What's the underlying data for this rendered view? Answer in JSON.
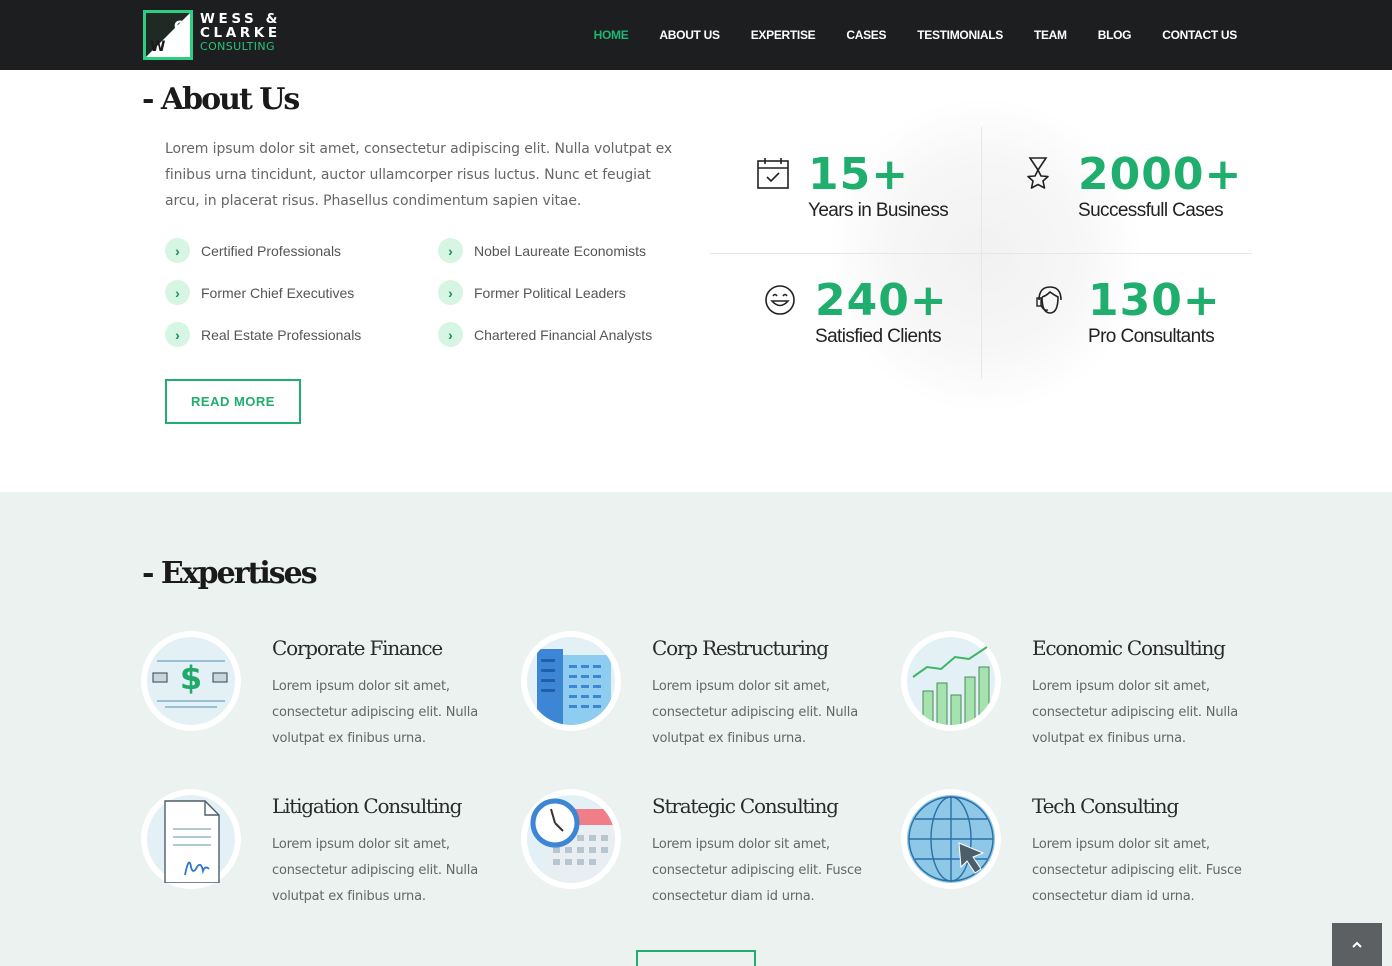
{
  "brand": {
    "line1": "WESS &",
    "line2": "CLARKE",
    "line3": "CONSULTING",
    "mark_letter_top": "C",
    "mark_letter_bottom": "W",
    "accent": "#1fae6d"
  },
  "nav": {
    "items": [
      {
        "label": "HOME",
        "active": true
      },
      {
        "label": "ABOUT US"
      },
      {
        "label": "EXPERTISE"
      },
      {
        "label": "CASES"
      },
      {
        "label": "TESTIMONIALS"
      },
      {
        "label": "TEAM"
      },
      {
        "label": "BLOG"
      },
      {
        "label": "CONTACT US"
      }
    ]
  },
  "about": {
    "title": "- About Us",
    "text": "Lorem ipsum dolor sit amet, consectetur adipiscing elit. Nulla volutpat ex finibus urna tincidunt, auctor ullamcorper risus luctus. Nunc et feugiat arcu, in placerat risus. Phasellus condimentum sapien vitae.",
    "features": [
      "Certified Professionals",
      "Nobel Laureate Economists",
      "Former Chief Executives",
      "Former Political Leaders",
      "Real Estate Professionals",
      "Chartered Financial Analysts"
    ],
    "read_more": "READ MORE"
  },
  "stats": [
    {
      "number": "15+",
      "label": "Years in Business",
      "icon": "calendar-check-icon"
    },
    {
      "number": "2000+",
      "label": "Successfull Cases",
      "icon": "award-icon"
    },
    {
      "number": "240+",
      "label": "Satisfied Clients",
      "icon": "smile-icon"
    },
    {
      "number": "130+",
      "label": "Pro Consultants",
      "icon": "headset-icon"
    }
  ],
  "expertise": {
    "title": "- Expertises",
    "items": [
      {
        "name": "Corporate Finance",
        "desc": "Lorem ipsum dolor sit amet, consectetur adipiscing elit. Nulla volutpat ex finibus urna.",
        "icon": "dollar-note-icon"
      },
      {
        "name": "Corp Restructuring",
        "desc": "Lorem ipsum dolor sit amet, consectetur adipiscing elit. Nulla volutpat ex finibus urna.",
        "icon": "buildings-icon"
      },
      {
        "name": "Economic Consulting",
        "desc": "Lorem ipsum dolor sit amet, consectetur adipiscing elit. Nulla volutpat ex finibus urna.",
        "icon": "growth-chart-icon"
      },
      {
        "name": "Litigation Consulting",
        "desc": "Lorem ipsum dolor sit amet, consectetur adipiscing elit. Nulla volutpat ex finibus urna.",
        "icon": "signed-document-icon"
      },
      {
        "name": "Strategic Consulting",
        "desc": "Lorem ipsum dolor sit amet, consectetur adipiscing elit. Fusce consectetur diam id urna.",
        "icon": "clock-calendar-icon"
      },
      {
        "name": "Tech Consulting",
        "desc": "Lorem ipsum dolor sit amet, consectetur adipiscing elit. Fusce consectetur diam id urna.",
        "icon": "globe-cursor-icon"
      }
    ]
  },
  "scroll_top": {
    "icon": "chevron-up-icon"
  }
}
